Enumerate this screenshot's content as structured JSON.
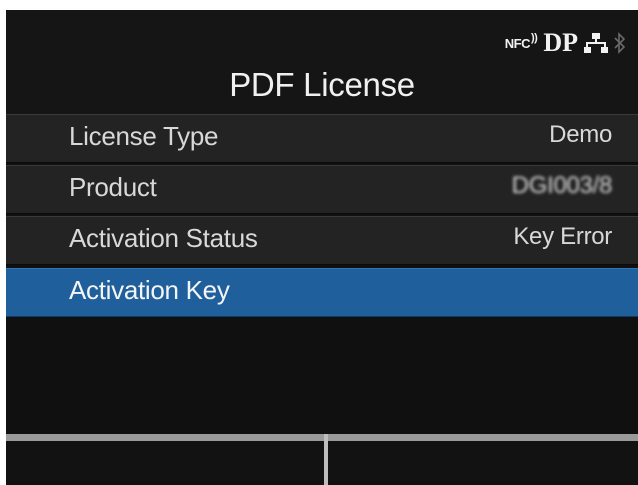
{
  "screen": {
    "title": "PDF License",
    "status_icons": {
      "nfc": "NFC",
      "dp": "DP"
    },
    "menu": [
      {
        "label": "License Type",
        "value": "Demo"
      },
      {
        "label": "Product",
        "value": "DGI003/8"
      },
      {
        "label": "Activation Status",
        "value": "Key Error"
      },
      {
        "label": "Activation Key",
        "value": ""
      }
    ],
    "selected_index": 3,
    "icons": [
      "nfc-icon",
      "dp-icon",
      "network-icon",
      "bluetooth-icon"
    ],
    "colors": {
      "background": "#101010",
      "row": "#232323",
      "selected": "#1e5f9c",
      "text": "#e6e6e6"
    }
  }
}
